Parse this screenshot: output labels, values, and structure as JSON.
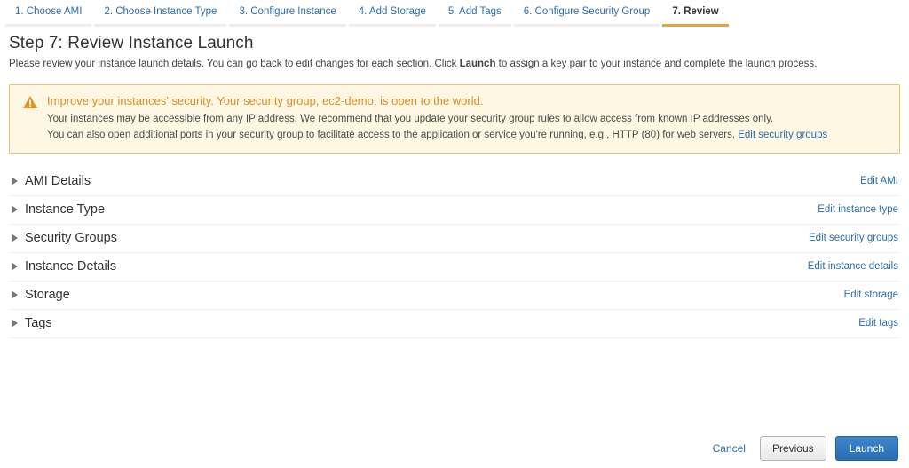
{
  "wizard": {
    "tabs": [
      {
        "label": "1. Choose AMI",
        "active": false
      },
      {
        "label": "2. Choose Instance Type",
        "active": false
      },
      {
        "label": "3. Configure Instance",
        "active": false
      },
      {
        "label": "4. Add Storage",
        "active": false
      },
      {
        "label": "5. Add Tags",
        "active": false
      },
      {
        "label": "6. Configure Security Group",
        "active": false
      },
      {
        "label": "7. Review",
        "active": true
      }
    ]
  },
  "page": {
    "title": "Step 7: Review Instance Launch",
    "description_pre": "Please review your instance launch details. You can go back to edit changes for each section. Click ",
    "description_bold": "Launch",
    "description_post": " to assign a key pair to your instance and complete the launch process."
  },
  "warning": {
    "icon": "warning-triangle-icon",
    "title": "Improve your instances' security. Your security group, ec2-demo, is open to the world.",
    "line1": "Your instances may be accessible from any IP address. We recommend that you update your security group rules to allow access from known IP addresses only.",
    "line2_pre": "You can also open additional ports in your security group to facilitate access to the application or service you're running, e.g., HTTP (80) for web servers. ",
    "line2_link": "Edit security groups",
    "colors": {
      "background": "#fdf7e3",
      "border": "#e0c677",
      "title_text": "#d78f26",
      "icon": "#e09625"
    }
  },
  "sections": [
    {
      "title": "AMI Details",
      "edit_label": "Edit AMI",
      "name": "ami-details"
    },
    {
      "title": "Instance Type",
      "edit_label": "Edit instance type",
      "name": "instance-type"
    },
    {
      "title": "Security Groups",
      "edit_label": "Edit security groups",
      "name": "security-groups"
    },
    {
      "title": "Instance Details",
      "edit_label": "Edit instance details",
      "name": "instance-details"
    },
    {
      "title": "Storage",
      "edit_label": "Edit storage",
      "name": "storage"
    },
    {
      "title": "Tags",
      "edit_label": "Edit tags",
      "name": "tags"
    }
  ],
  "footer": {
    "cancel_label": "Cancel",
    "previous_label": "Previous",
    "launch_label": "Launch"
  },
  "theme": {
    "link_blue": "#2c6eab",
    "active_tab_underline": "#e8a33d",
    "launch_button": "#2a6fb5"
  }
}
